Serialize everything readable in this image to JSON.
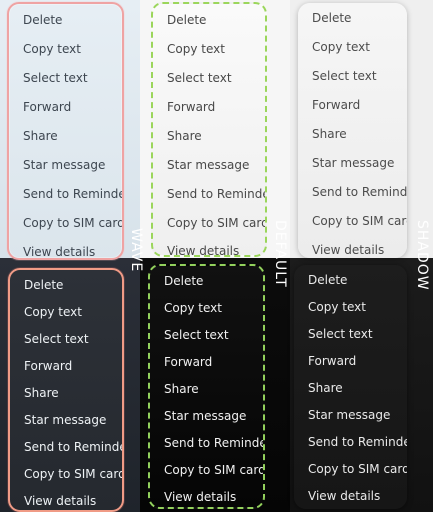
{
  "labels": {
    "wave": "WAVE",
    "default": "DEFAULT",
    "shadow": "SHADOW"
  },
  "menu_items": [
    "Delete",
    "Copy text",
    "Select text",
    "Forward",
    "Share",
    "Star message",
    "Send to Reminder",
    "Copy to SIM card",
    "View details"
  ]
}
